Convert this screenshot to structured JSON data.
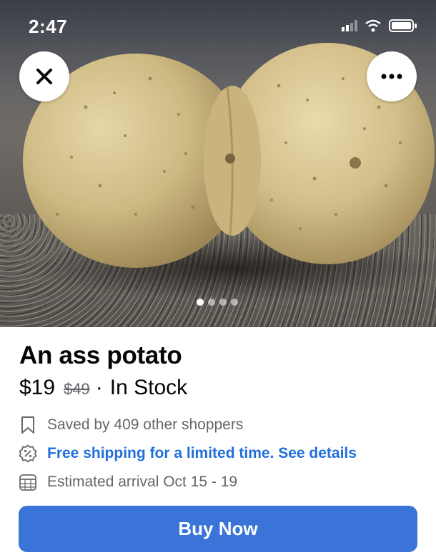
{
  "status_bar": {
    "time": "2:47"
  },
  "image_carousel": {
    "total_images": 4,
    "active_index": 0
  },
  "product": {
    "title": "An ass potato",
    "price": "$19",
    "original_price": "$49",
    "separator": "·",
    "availability": "In Stock"
  },
  "info": {
    "saved_text": "Saved by 409 other shoppers",
    "shipping_text": "Free shipping for a limited time. See details",
    "arrival_text": "Estimated arrival Oct 15 - 19"
  },
  "actions": {
    "buy_label": "Buy Now"
  },
  "colors": {
    "accent": "#3a74d8",
    "link": "#216fdb",
    "muted": "#65676b"
  }
}
